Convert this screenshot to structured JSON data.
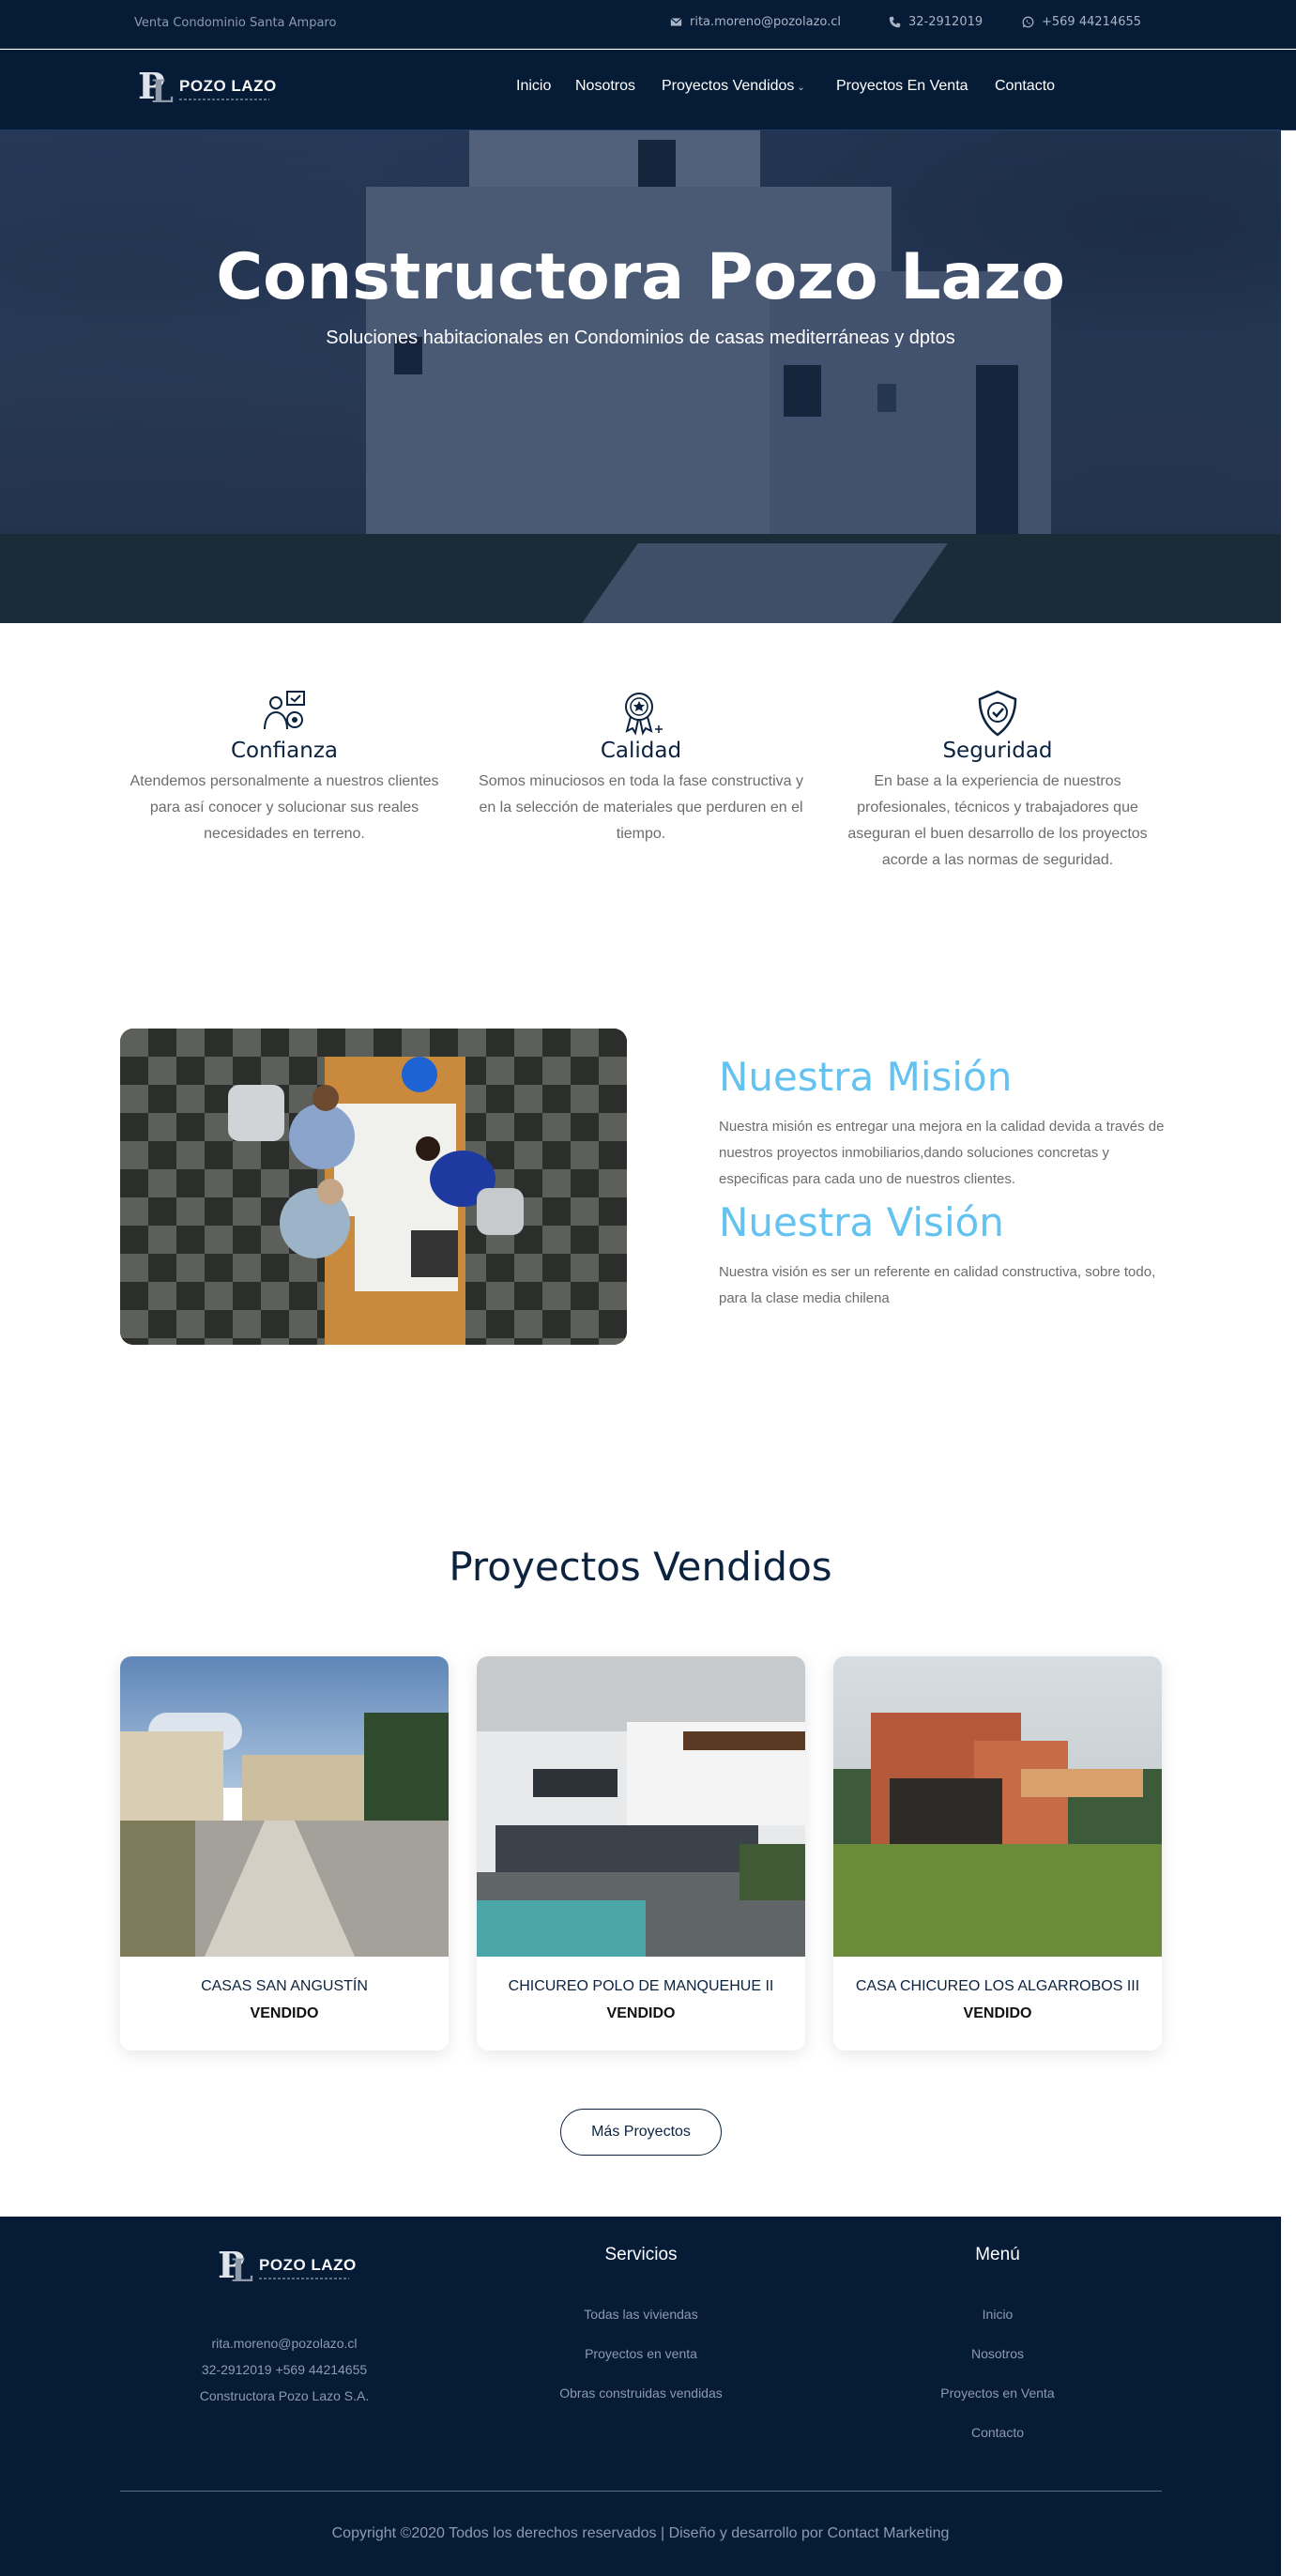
{
  "topbar": {
    "promo": "Venta Condominio Santa Amparo",
    "email": "rita.moreno@pozolazo.cl",
    "phone": "32-2912019",
    "whatsapp": "+569 44214655"
  },
  "logo": {
    "name_part1": "POZO",
    "name_part2": "LAZO"
  },
  "nav": {
    "items": [
      "Inicio",
      "Nosotros",
      "Proyectos Vendidos",
      "Proyectos En Venta",
      "Contacto"
    ]
  },
  "hero": {
    "title": "Constructora Pozo Lazo",
    "subtitle": "Soluciones habitacionales en Condominios de casas mediterráneas y dptos"
  },
  "features": [
    {
      "icon": "handshake-people-icon",
      "title": "Confianza",
      "description": "Atendemos personalmente a nuestros clientes para así conocer y solucionar sus reales necesidades en terreno."
    },
    {
      "icon": "quality-badge-icon",
      "title": "Calidad",
      "description": "Somos minuciosos en toda la fase constructiva y en la selección de materiales que perduren en el tiempo."
    },
    {
      "icon": "shield-check-icon",
      "title": "Seguridad",
      "description": "En base a la experiencia de nuestros profesionales, técnicos y trabajadores que aseguran el buen desarrollo de los proyectos acorde a las normas de seguridad."
    }
  ],
  "mission": {
    "title": "Nuestra Misión",
    "text": "Nuestra misión es entregar una mejora en la calidad devida a través de nuestros proyectos inmobiliarios,dando soluciones concretas y especificas para cada uno de nuestros clientes."
  },
  "vision": {
    "title": "Nuestra Visión",
    "text": "Nuestra visión es ser un referente en calidad constructiva, sobre todo, para la clase media chilena"
  },
  "projects": {
    "title": "Proyectos Vendidos",
    "cards": [
      {
        "name": "CASAS SAN ANGUSTÍN",
        "status": "VENDIDO"
      },
      {
        "name": "CHICUREO POLO DE MANQUEHUE II",
        "status": "VENDIDO"
      },
      {
        "name": "CASA CHICUREO LOS ALGARROBOS III",
        "status": "VENDIDO"
      }
    ],
    "more_button": "Más Proyectos"
  },
  "footer": {
    "contact": {
      "email": "rita.moreno@pozolazo.cl",
      "phones": "32-2912019 +569 44214655",
      "company": "Constructora Pozo Lazo S.A."
    },
    "services": {
      "title": "Servicios",
      "links": [
        "Todas las viviendas",
        "Proyectos en venta",
        "Obras construidas vendidas"
      ]
    },
    "menu": {
      "title": "Menú",
      "links": [
        "Inicio",
        "Nosotros",
        "Proyectos en Venta",
        "Contacto"
      ]
    },
    "copyright": "Copyright ©2020 Todos los derechos reservados | Diseño y desarrollo por Contact Marketing"
  },
  "colors": {
    "navy": "#061b36",
    "heading": "#0c2340",
    "accent_blue": "#63c2f0"
  }
}
